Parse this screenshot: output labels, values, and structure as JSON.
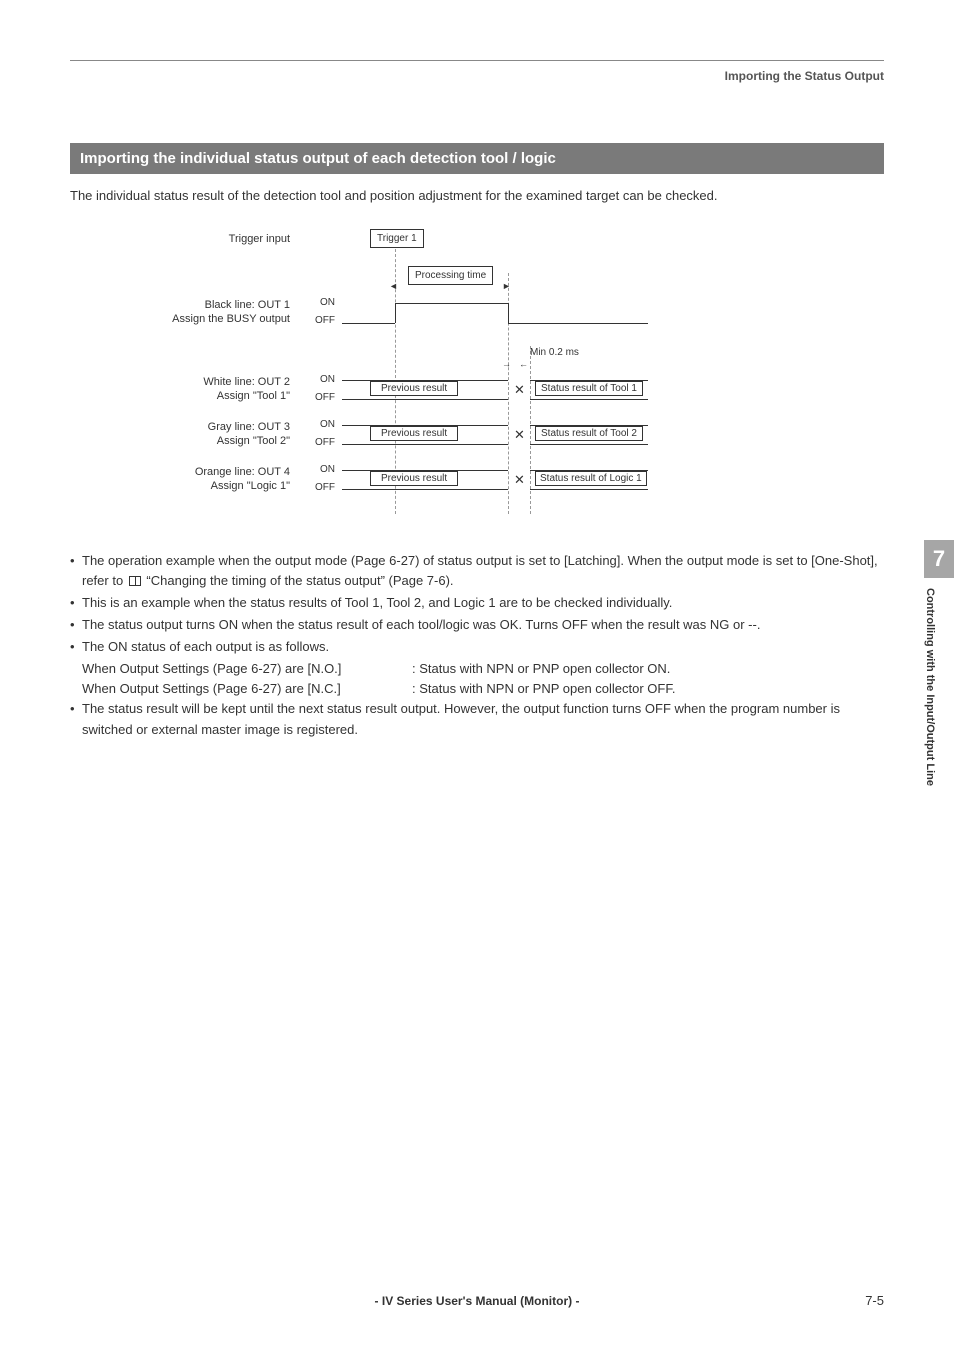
{
  "header": {
    "breadcrumb": "Importing the Status Output"
  },
  "section": {
    "title": "Importing the individual status output of each detection tool / logic"
  },
  "intro": "The individual status result of the detection tool and position adjustment for the examined target can be checked.",
  "diagram": {
    "trigger_input": "Trigger input",
    "trigger1": "Trigger 1",
    "processing_time": "Processing time",
    "min": "Min 0.2 ms",
    "rows": [
      {
        "name": "Black line: OUT 1",
        "assign": "Assign the BUSY output",
        "on": "ON",
        "off": "OFF"
      },
      {
        "name": "White line: OUT 2",
        "assign": "Assign \"Tool 1\"",
        "on": "ON",
        "off": "OFF"
      },
      {
        "name": "Gray line: OUT 3",
        "assign": "Assign \"Tool 2\"",
        "on": "ON",
        "off": "OFF"
      },
      {
        "name": "Orange line: OUT 4",
        "assign": "Assign \"Logic 1\"",
        "on": "ON",
        "off": "OFF"
      }
    ],
    "prev": "Previous result",
    "status1": "Status result of Tool 1",
    "status2": "Status result of Tool 2",
    "status3": "Status result of Logic 1"
  },
  "bullets": {
    "b1a": "The operation example when the output mode (Page 6-27) of status output is set to [Latching]. When the output mode is set to [One-Shot], refer to ",
    "b1b": " “Changing the timing of the status output” (Page 7-6).",
    "b2": "This is an example when the status results of Tool 1, Tool 2, and Logic 1 are to be checked individually.",
    "b3": "The status output turns ON when the status result of each tool/logic was OK. Turns OFF when the result was NG or --.",
    "b4": "The ON status of each output is as follows.",
    "b4_no_l": "When Output Settings (Page 6-27) are [N.O.]",
    "b4_no_r": ": Status with NPN or PNP open collector ON.",
    "b4_nc_l": "When Output Settings (Page 6-27) are [N.C.]",
    "b4_nc_r": ": Status with NPN or PNP open collector OFF.",
    "b5": "The status result will be kept until the next status result output. However, the output function turns OFF when the program number is switched or external master image is registered."
  },
  "side": {
    "num": "7",
    "text": "Controlling with the Input/Output Line"
  },
  "footer": {
    "center": "- IV Series User's Manual (Monitor) -",
    "page": "7-5"
  }
}
